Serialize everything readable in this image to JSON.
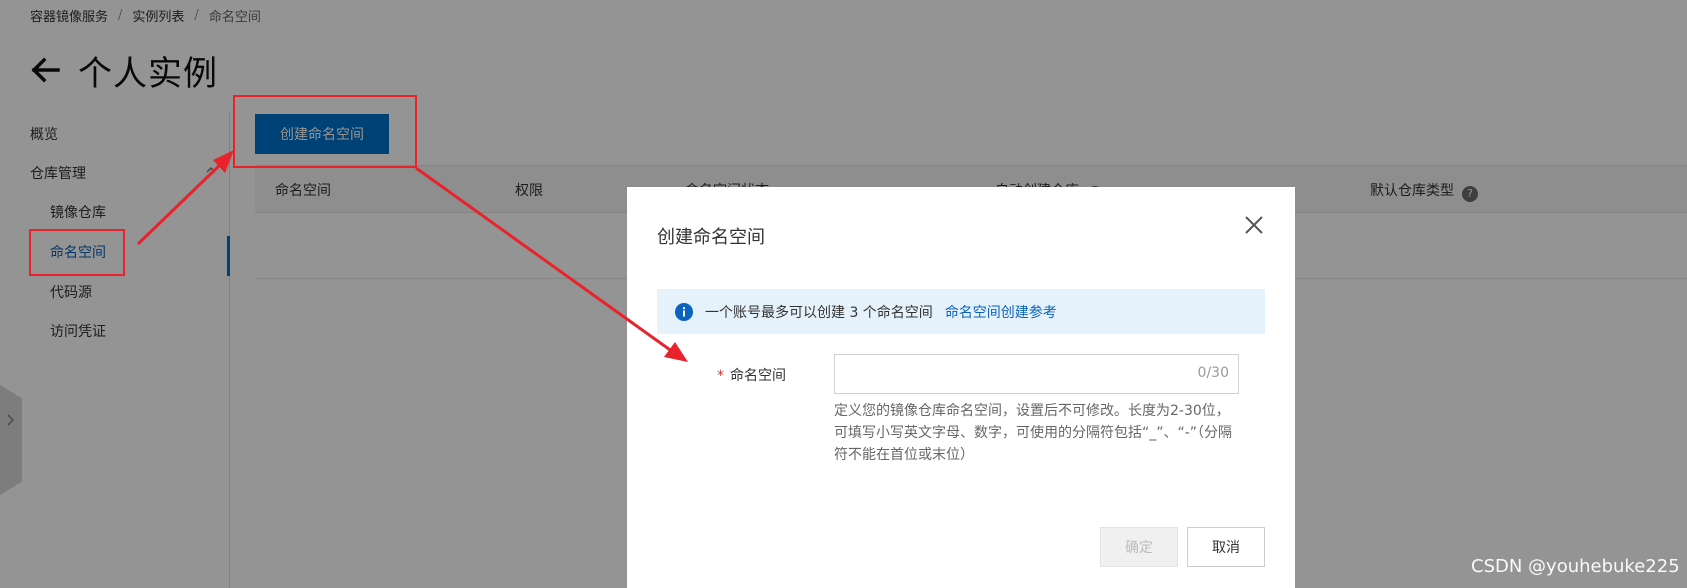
{
  "breadcrumb": {
    "items": [
      "容器镜像服务",
      "实例列表",
      "命名空间"
    ],
    "separator": "/"
  },
  "page": {
    "title": "个人实例"
  },
  "sidebar": {
    "items": [
      {
        "label": "概览"
      },
      {
        "label": "仓库管理"
      },
      {
        "label": "镜像仓库"
      },
      {
        "label": "命名空间",
        "active": true
      },
      {
        "label": "代码源"
      },
      {
        "label": "访问凭证"
      }
    ]
  },
  "toolbar": {
    "create_label": "创建命名空间"
  },
  "table": {
    "columns": [
      "命名空间",
      "权限",
      "命名空间状态",
      "自动创建仓库",
      "默认仓库类型"
    ],
    "help_glyph": "?"
  },
  "modal": {
    "title": "创建命名空间",
    "info_text": "一个账号最多可以创建 3 个命名空间",
    "info_link": "命名空间创建参考",
    "field_required": "*",
    "field_label": "命名空间",
    "field_value": "",
    "char_count": "0/30",
    "help_text": "定义您的镜像仓库命名空间，设置后不可修改。长度为2-30位，可填写小写英文字母、数字，可使用的分隔符包括“_”、“-”（分隔符不能在首位或末位）",
    "ok_label": "确定",
    "ok_disabled": true,
    "cancel_label": "取消"
  },
  "watermark": {
    "text": "CSDN @youhebuke225"
  },
  "colors": {
    "primary": "#0070cc",
    "annotation": "#e8232b",
    "info_bg": "#e6f2fb",
    "link": "#0b63c0"
  }
}
